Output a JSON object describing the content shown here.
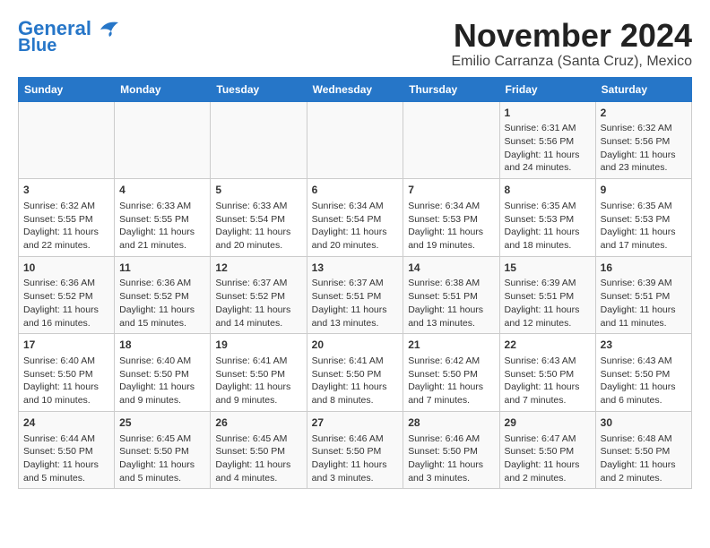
{
  "header": {
    "logo_line1": "General",
    "logo_line2": "Blue",
    "title": "November 2024",
    "subtitle": "Emilio Carranza (Santa Cruz), Mexico"
  },
  "weekdays": [
    "Sunday",
    "Monday",
    "Tuesday",
    "Wednesday",
    "Thursday",
    "Friday",
    "Saturday"
  ],
  "weeks": [
    [
      {
        "day": "",
        "info": ""
      },
      {
        "day": "",
        "info": ""
      },
      {
        "day": "",
        "info": ""
      },
      {
        "day": "",
        "info": ""
      },
      {
        "day": "",
        "info": ""
      },
      {
        "day": "1",
        "info": "Sunrise: 6:31 AM\nSunset: 5:56 PM\nDaylight: 11 hours and 24 minutes."
      },
      {
        "day": "2",
        "info": "Sunrise: 6:32 AM\nSunset: 5:56 PM\nDaylight: 11 hours and 23 minutes."
      }
    ],
    [
      {
        "day": "3",
        "info": "Sunrise: 6:32 AM\nSunset: 5:55 PM\nDaylight: 11 hours and 22 minutes."
      },
      {
        "day": "4",
        "info": "Sunrise: 6:33 AM\nSunset: 5:55 PM\nDaylight: 11 hours and 21 minutes."
      },
      {
        "day": "5",
        "info": "Sunrise: 6:33 AM\nSunset: 5:54 PM\nDaylight: 11 hours and 20 minutes."
      },
      {
        "day": "6",
        "info": "Sunrise: 6:34 AM\nSunset: 5:54 PM\nDaylight: 11 hours and 20 minutes."
      },
      {
        "day": "7",
        "info": "Sunrise: 6:34 AM\nSunset: 5:53 PM\nDaylight: 11 hours and 19 minutes."
      },
      {
        "day": "8",
        "info": "Sunrise: 6:35 AM\nSunset: 5:53 PM\nDaylight: 11 hours and 18 minutes."
      },
      {
        "day": "9",
        "info": "Sunrise: 6:35 AM\nSunset: 5:53 PM\nDaylight: 11 hours and 17 minutes."
      }
    ],
    [
      {
        "day": "10",
        "info": "Sunrise: 6:36 AM\nSunset: 5:52 PM\nDaylight: 11 hours and 16 minutes."
      },
      {
        "day": "11",
        "info": "Sunrise: 6:36 AM\nSunset: 5:52 PM\nDaylight: 11 hours and 15 minutes."
      },
      {
        "day": "12",
        "info": "Sunrise: 6:37 AM\nSunset: 5:52 PM\nDaylight: 11 hours and 14 minutes."
      },
      {
        "day": "13",
        "info": "Sunrise: 6:37 AM\nSunset: 5:51 PM\nDaylight: 11 hours and 13 minutes."
      },
      {
        "day": "14",
        "info": "Sunrise: 6:38 AM\nSunset: 5:51 PM\nDaylight: 11 hours and 13 minutes."
      },
      {
        "day": "15",
        "info": "Sunrise: 6:39 AM\nSunset: 5:51 PM\nDaylight: 11 hours and 12 minutes."
      },
      {
        "day": "16",
        "info": "Sunrise: 6:39 AM\nSunset: 5:51 PM\nDaylight: 11 hours and 11 minutes."
      }
    ],
    [
      {
        "day": "17",
        "info": "Sunrise: 6:40 AM\nSunset: 5:50 PM\nDaylight: 11 hours and 10 minutes."
      },
      {
        "day": "18",
        "info": "Sunrise: 6:40 AM\nSunset: 5:50 PM\nDaylight: 11 hours and 9 minutes."
      },
      {
        "day": "19",
        "info": "Sunrise: 6:41 AM\nSunset: 5:50 PM\nDaylight: 11 hours and 9 minutes."
      },
      {
        "day": "20",
        "info": "Sunrise: 6:41 AM\nSunset: 5:50 PM\nDaylight: 11 hours and 8 minutes."
      },
      {
        "day": "21",
        "info": "Sunrise: 6:42 AM\nSunset: 5:50 PM\nDaylight: 11 hours and 7 minutes."
      },
      {
        "day": "22",
        "info": "Sunrise: 6:43 AM\nSunset: 5:50 PM\nDaylight: 11 hours and 7 minutes."
      },
      {
        "day": "23",
        "info": "Sunrise: 6:43 AM\nSunset: 5:50 PM\nDaylight: 11 hours and 6 minutes."
      }
    ],
    [
      {
        "day": "24",
        "info": "Sunrise: 6:44 AM\nSunset: 5:50 PM\nDaylight: 11 hours and 5 minutes."
      },
      {
        "day": "25",
        "info": "Sunrise: 6:45 AM\nSunset: 5:50 PM\nDaylight: 11 hours and 5 minutes."
      },
      {
        "day": "26",
        "info": "Sunrise: 6:45 AM\nSunset: 5:50 PM\nDaylight: 11 hours and 4 minutes."
      },
      {
        "day": "27",
        "info": "Sunrise: 6:46 AM\nSunset: 5:50 PM\nDaylight: 11 hours and 3 minutes."
      },
      {
        "day": "28",
        "info": "Sunrise: 6:46 AM\nSunset: 5:50 PM\nDaylight: 11 hours and 3 minutes."
      },
      {
        "day": "29",
        "info": "Sunrise: 6:47 AM\nSunset: 5:50 PM\nDaylight: 11 hours and 2 minutes."
      },
      {
        "day": "30",
        "info": "Sunrise: 6:48 AM\nSunset: 5:50 PM\nDaylight: 11 hours and 2 minutes."
      }
    ]
  ]
}
